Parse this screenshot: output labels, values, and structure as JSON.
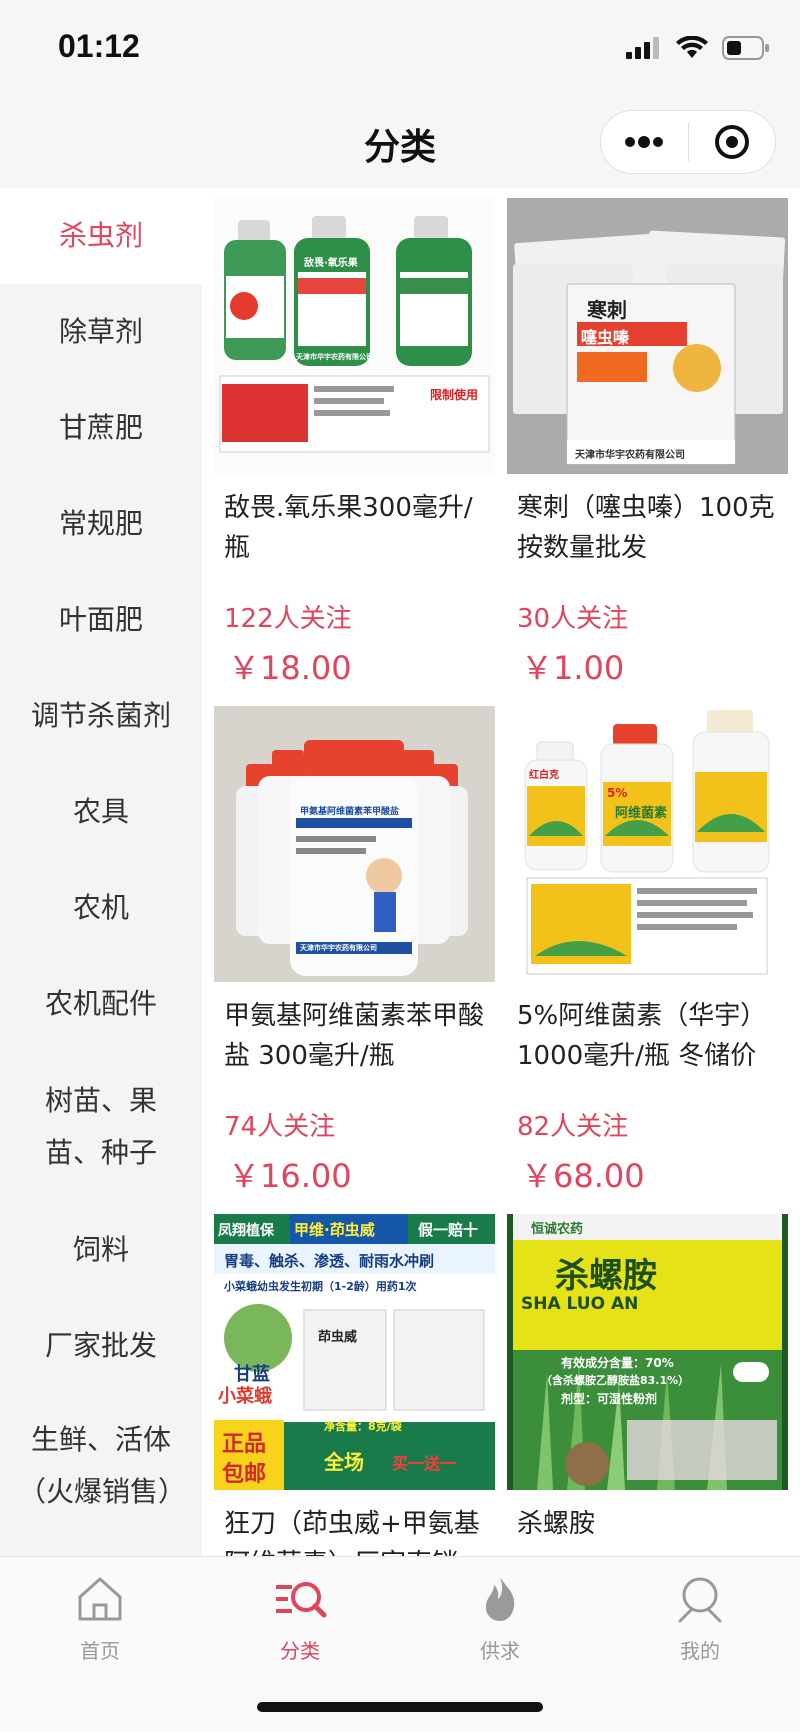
{
  "status": {
    "time": "01:12"
  },
  "nav": {
    "title": "分类"
  },
  "sidebar": {
    "items": [
      {
        "label": "杀虫剂",
        "active": true
      },
      {
        "label": "除草剂"
      },
      {
        "label": "甘蔗肥"
      },
      {
        "label": "常规肥"
      },
      {
        "label": "叶面肥"
      },
      {
        "label": "调节杀菌剂"
      },
      {
        "label": "农具"
      },
      {
        "label": "农机"
      },
      {
        "label": "农机配件"
      },
      {
        "label": "树苗、果苗、种子"
      },
      {
        "label": "饲料"
      },
      {
        "label": "厂家批发"
      },
      {
        "label": "生鲜、活体（火爆销售）"
      }
    ]
  },
  "products": [
    {
      "title": "敌畏.氧乐果300毫升/瓶",
      "follow": "122人关注",
      "price": "￥18.00",
      "img": {
        "label_a": "敌畏·氧乐果",
        "label_b": "限制使用",
        "label_c": "天津市华宇农药有限公司"
      }
    },
    {
      "title": "寒刺（噻虫嗪）100克 按数量批发",
      "follow": "30人关注",
      "price": "￥1.00",
      "img": {
        "label_a": "寒刺",
        "label_b": "噻虫嗪",
        "label_c": "天津市华宇农药有限公司"
      }
    },
    {
      "title": "甲氨基阿维菌素苯甲酸盐 300毫升/瓶",
      "follow": "74人关注",
      "price": "￥16.00",
      "img": {
        "label_a": "甲氨基阿维菌素苯甲酸盐",
        "label_c": "天津市华宇农药有限公司"
      }
    },
    {
      "title": "5%阿维菌素（华宇）1000毫升/瓶 冬储价",
      "follow": "82人关注",
      "price": "￥68.00",
      "img": {
        "label_a": "红白克",
        "label_b": "阿维菌素",
        "label_c": "5%"
      }
    },
    {
      "title": "狂刀（茚虫威+甲氨基阿维菌素）厂家直销",
      "follow": "",
      "price": "",
      "img": {
        "t1": "凤翔植保",
        "t2": "甲维·茚虫威",
        "t3": "假一赔十",
        "t4": "胃毒、触杀、渗透、耐雨水冲刷",
        "t5": "小菜蛾幼虫发生初期（1-2龄）用药1次",
        "t6": "甘蓝",
        "t7": "小菜蛾",
        "t8": "正品",
        "t9": "包邮",
        "t10": "净含量：8克/袋",
        "t11": "全场",
        "t12": "买一送一",
        "t13": "茚虫威"
      }
    },
    {
      "title": "杀螺胺",
      "follow": "",
      "price": "",
      "img": {
        "t1": "杀螺胺",
        "t2": "SHA LUO AN",
        "t3": "有效成分含量：70%",
        "t4": "（含杀螺胺乙醇胺盐83.1%）",
        "t5": "剂型：可湿性粉剂",
        "t6": "恒诚农药"
      }
    }
  ],
  "tabbar": {
    "items": [
      {
        "label": "首页"
      },
      {
        "label": "分类",
        "active": true
      },
      {
        "label": "供求"
      },
      {
        "label": "我的"
      }
    ]
  },
  "colors": {
    "accent": "#e0455d",
    "inactive": "#999999"
  }
}
